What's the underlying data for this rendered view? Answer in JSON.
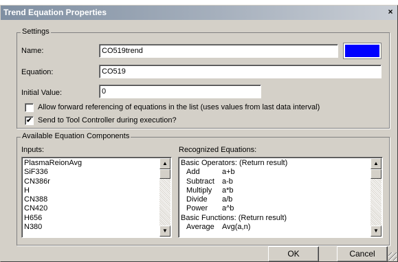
{
  "dialog": {
    "title": "Trend Equation Properties",
    "close_glyph": "×"
  },
  "settings": {
    "group_label": "Settings",
    "name_label": "Name:",
    "name_value": "CO519trend",
    "color_swatch": "#0000ff",
    "equation_label": "Equation:",
    "equation_value": "CO519",
    "initial_label": "Initial Value:",
    "initial_value": "0",
    "allow_forward": {
      "label": "Allow forward referencing of equations in the list (uses values from last data interval)",
      "checked": false
    },
    "send_tool": {
      "label": "Send to Tool Controller during execution?",
      "checked": true,
      "check_glyph": "✔"
    }
  },
  "components": {
    "group_label": "Available Equation Components",
    "inputs_label": "Inputs:",
    "inputs": [
      "PlasmaReionAvg",
      "SiF336",
      "CN386r",
      "H",
      "CN388",
      "CN420",
      "H656",
      "N380"
    ],
    "recognized_label": "Recognized Equations:",
    "recognized": [
      {
        "name": "Basic Operators: (Return result)",
        "expr": "",
        "header": true
      },
      {
        "name": "Add",
        "expr": "a+b",
        "header": false
      },
      {
        "name": "Subtract",
        "expr": "a-b",
        "header": false
      },
      {
        "name": "Multiply",
        "expr": "a*b",
        "header": false
      },
      {
        "name": "Divide",
        "expr": "a/b",
        "header": false
      },
      {
        "name": "Power",
        "expr": "a^b",
        "header": false
      },
      {
        "name": "Basic Functions: (Return result)",
        "expr": "",
        "header": true
      },
      {
        "name": "Average",
        "expr": "Avg(a,n)",
        "header": false
      }
    ],
    "scroll_up_glyph": "▲",
    "scroll_down_glyph": "▼"
  },
  "buttons": {
    "ok": "OK",
    "cancel": "Cancel"
  }
}
